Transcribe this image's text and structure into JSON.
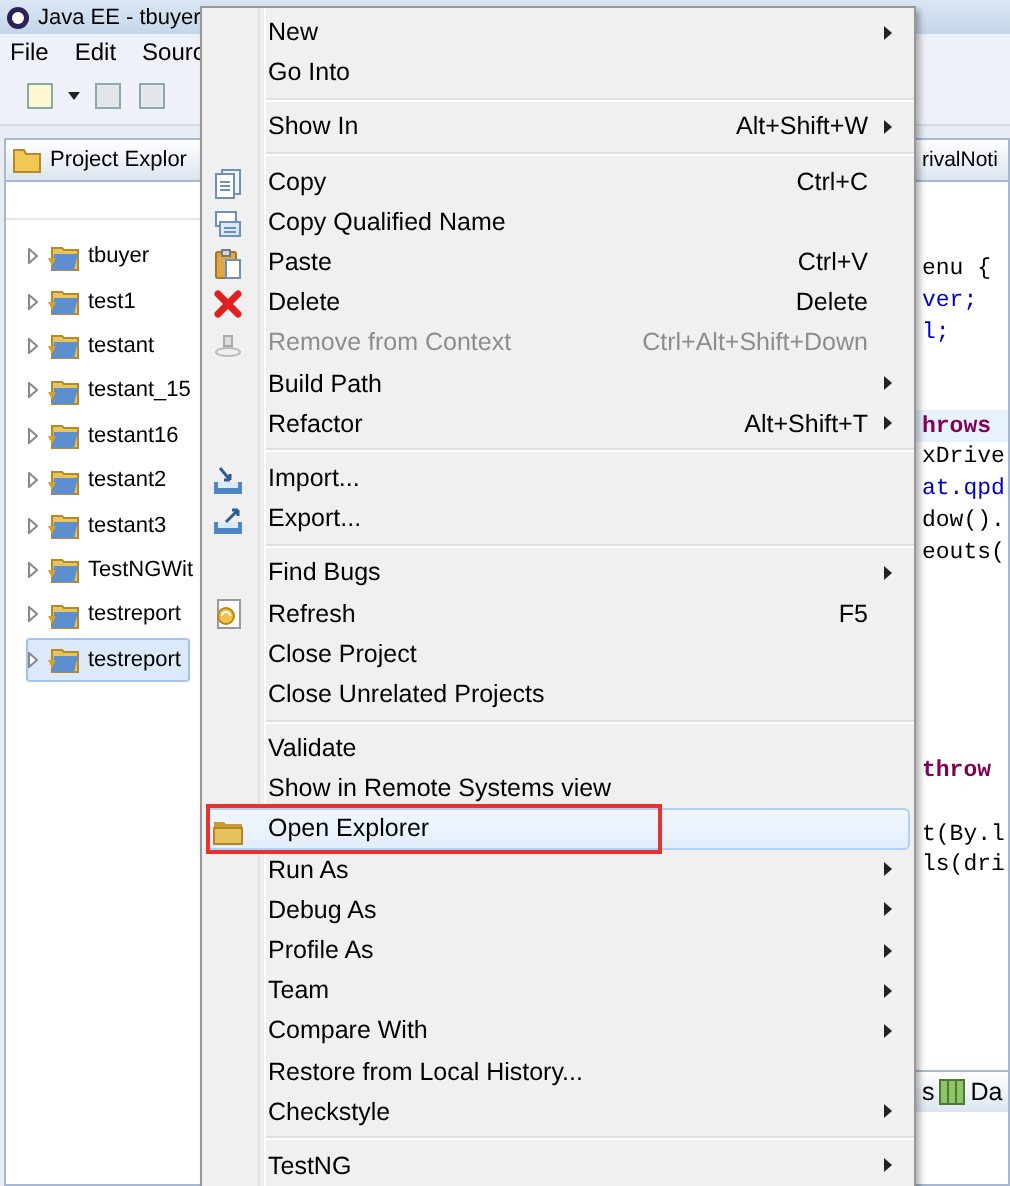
{
  "window": {
    "title": "Java EE - tbuyer"
  },
  "menu_bar": [
    "File",
    "Edit",
    "Sourc"
  ],
  "project_explorer": {
    "tab": "Project Explor",
    "items": [
      {
        "label": "tbuyer",
        "selected": false
      },
      {
        "label": "test1",
        "selected": false
      },
      {
        "label": "testant",
        "selected": false
      },
      {
        "label": "testant_15",
        "selected": false
      },
      {
        "label": "testant16",
        "selected": false
      },
      {
        "label": "testant2",
        "selected": false
      },
      {
        "label": "testant3",
        "selected": false
      },
      {
        "label": "TestNGWit",
        "selected": false
      },
      {
        "label": "testreport",
        "selected": false
      },
      {
        "label": "testreport",
        "selected": true
      }
    ]
  },
  "editor": {
    "tab": "rivalNoti",
    "lines": [
      {
        "kind": "plain",
        "text": "enu {",
        "current": false
      },
      {
        "kind": "field",
        "text": "ver;",
        "current": false
      },
      {
        "kind": "field",
        "text": "l;",
        "current": false
      },
      {
        "kind": "blank"
      },
      {
        "kind": "blank"
      },
      {
        "kind": "keyword",
        "text": "hrows",
        "current": true
      },
      {
        "kind": "plain",
        "text": "xDrive",
        "current": false
      },
      {
        "kind": "field",
        "text": "at.qpd",
        "current": false
      },
      {
        "kind": "plain",
        "text": "dow().",
        "current": false
      },
      {
        "kind": "plain",
        "text": "eouts(",
        "current": false
      },
      {
        "kind": "blank"
      },
      {
        "kind": "blank"
      },
      {
        "kind": "blank"
      },
      {
        "kind": "blank"
      },
      {
        "kind": "blank"
      },
      {
        "kind": "blank"
      },
      {
        "kind": "keyword",
        "text": "throw",
        "current": false
      },
      {
        "kind": "blank"
      },
      {
        "kind": "plain",
        "text": "t(By.l",
        "current": false
      },
      {
        "kind": "plain",
        "text": "ls(dri",
        "current": false
      }
    ]
  },
  "bottom_tabs": [
    "s",
    "Da"
  ],
  "context_menu": [
    {
      "kind": "item",
      "label": "New",
      "submenu": true,
      "disabled": false,
      "selected": false
    },
    {
      "kind": "item",
      "label": "Go Into",
      "submenu": false,
      "disabled": false,
      "selected": false
    },
    {
      "kind": "separator"
    },
    {
      "kind": "item",
      "label": "Show In",
      "shortcut": "Alt+Shift+W",
      "submenu": true,
      "disabled": false,
      "selected": false
    },
    {
      "kind": "separator"
    },
    {
      "kind": "item",
      "label": "Copy",
      "shortcut": "Ctrl+C",
      "submenu": false,
      "disabled": false,
      "selected": false
    },
    {
      "kind": "item",
      "label": "Copy Qualified Name",
      "submenu": false,
      "disabled": false,
      "selected": false
    },
    {
      "kind": "item",
      "label": "Paste",
      "shortcut": "Ctrl+V",
      "submenu": false,
      "disabled": false,
      "selected": false
    },
    {
      "kind": "item",
      "label": "Delete",
      "shortcut": "Delete",
      "submenu": false,
      "disabled": false,
      "selected": false
    },
    {
      "kind": "item",
      "label": "Remove from Context",
      "shortcut": "Ctrl+Alt+Shift+Down",
      "submenu": false,
      "disabled": true,
      "selected": false
    },
    {
      "kind": "item",
      "label": "Build Path",
      "submenu": true,
      "disabled": false,
      "selected": false
    },
    {
      "kind": "item",
      "label": "Refactor",
      "shortcut": "Alt+Shift+T",
      "submenu": true,
      "disabled": false,
      "selected": false
    },
    {
      "kind": "separator"
    },
    {
      "kind": "item",
      "label": "Import...",
      "submenu": false,
      "disabled": false,
      "selected": false
    },
    {
      "kind": "item",
      "label": "Export...",
      "submenu": false,
      "disabled": false,
      "selected": false
    },
    {
      "kind": "separator"
    },
    {
      "kind": "item",
      "label": "Find Bugs",
      "submenu": true,
      "disabled": false,
      "selected": false
    },
    {
      "kind": "item",
      "label": "Refresh",
      "shortcut": "F5",
      "submenu": false,
      "disabled": false,
      "selected": false
    },
    {
      "kind": "item",
      "label": "Close Project",
      "submenu": false,
      "disabled": false,
      "selected": false
    },
    {
      "kind": "item",
      "label": "Close Unrelated Projects",
      "submenu": false,
      "disabled": false,
      "selected": false
    },
    {
      "kind": "separator"
    },
    {
      "kind": "item",
      "label": "Validate",
      "submenu": false,
      "disabled": false,
      "selected": false
    },
    {
      "kind": "item",
      "label": "Show in Remote Systems view",
      "submenu": false,
      "disabled": false,
      "selected": false
    },
    {
      "kind": "item",
      "label": "Open Explorer",
      "submenu": false,
      "disabled": false,
      "selected": true,
      "annotated": true
    },
    {
      "kind": "item",
      "label": "Run As",
      "submenu": true,
      "disabled": false,
      "selected": false
    },
    {
      "kind": "item",
      "label": "Debug As",
      "submenu": true,
      "disabled": false,
      "selected": false
    },
    {
      "kind": "item",
      "label": "Profile As",
      "submenu": true,
      "disabled": false,
      "selected": false
    },
    {
      "kind": "item",
      "label": "Team",
      "submenu": true,
      "disabled": false,
      "selected": false
    },
    {
      "kind": "item",
      "label": "Compare With",
      "submenu": true,
      "disabled": false,
      "selected": false
    },
    {
      "kind": "item",
      "label": "Restore from Local History...",
      "submenu": false,
      "disabled": false,
      "selected": false
    },
    {
      "kind": "item",
      "label": "Checkstyle",
      "submenu": true,
      "disabled": false,
      "selected": false
    },
    {
      "kind": "separator"
    },
    {
      "kind": "item",
      "label": "TestNG",
      "submenu": true,
      "disabled": false,
      "selected": false
    }
  ]
}
